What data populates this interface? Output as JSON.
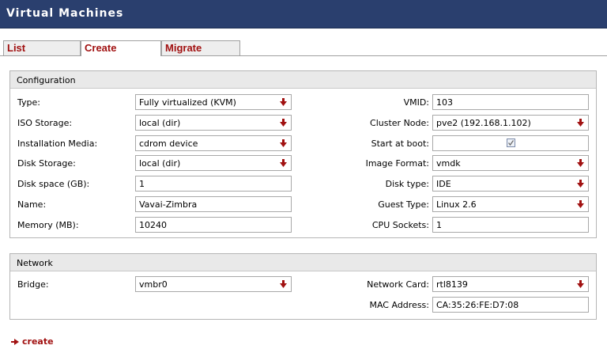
{
  "header": {
    "title": "Virtual Machines"
  },
  "tabs": [
    {
      "label": "List"
    },
    {
      "label": "Create"
    },
    {
      "label": "Migrate"
    }
  ],
  "configuration": {
    "section_title": "Configuration",
    "type": {
      "label": "Type:",
      "value": "Fully virtualized (KVM)"
    },
    "iso_storage": {
      "label": "ISO Storage:",
      "value": "local (dir)"
    },
    "installation_media": {
      "label": "Installation Media:",
      "value": "cdrom device"
    },
    "disk_storage": {
      "label": "Disk Storage:",
      "value": "local (dir)"
    },
    "disk_space": {
      "label": "Disk space (GB):",
      "value": "1"
    },
    "name": {
      "label": "Name:",
      "value": "Vavai-Zimbra"
    },
    "memory": {
      "label": "Memory (MB):",
      "value": "10240"
    },
    "vmid": {
      "label": "VMID:",
      "value": "103"
    },
    "cluster_node": {
      "label": "Cluster Node:",
      "value": "pve2 (192.168.1.102)"
    },
    "start_at_boot": {
      "label": "Start at boot:",
      "checked": true
    },
    "image_format": {
      "label": "Image Format:",
      "value": "vmdk"
    },
    "disk_type": {
      "label": "Disk type:",
      "value": "IDE"
    },
    "guest_type": {
      "label": "Guest Type:",
      "value": "Linux 2.6"
    },
    "cpu_sockets": {
      "label": "CPU Sockets:",
      "value": "1"
    }
  },
  "network": {
    "section_title": "Network",
    "bridge": {
      "label": "Bridge:",
      "value": "vmbr0"
    },
    "network_card": {
      "label": "Network Card:",
      "value": "rtl8139"
    },
    "mac_address": {
      "label": "MAC Address:",
      "value": "CA:35:26:FE:D7:08"
    }
  },
  "actions": {
    "create_label": "create"
  },
  "colors": {
    "header_bg": "#2a3f6e",
    "link": "#a11111",
    "arrow": "#a11111"
  },
  "icons": {
    "dropdown": "dropdown-arrow-icon",
    "create": "arrow-right-icon"
  }
}
